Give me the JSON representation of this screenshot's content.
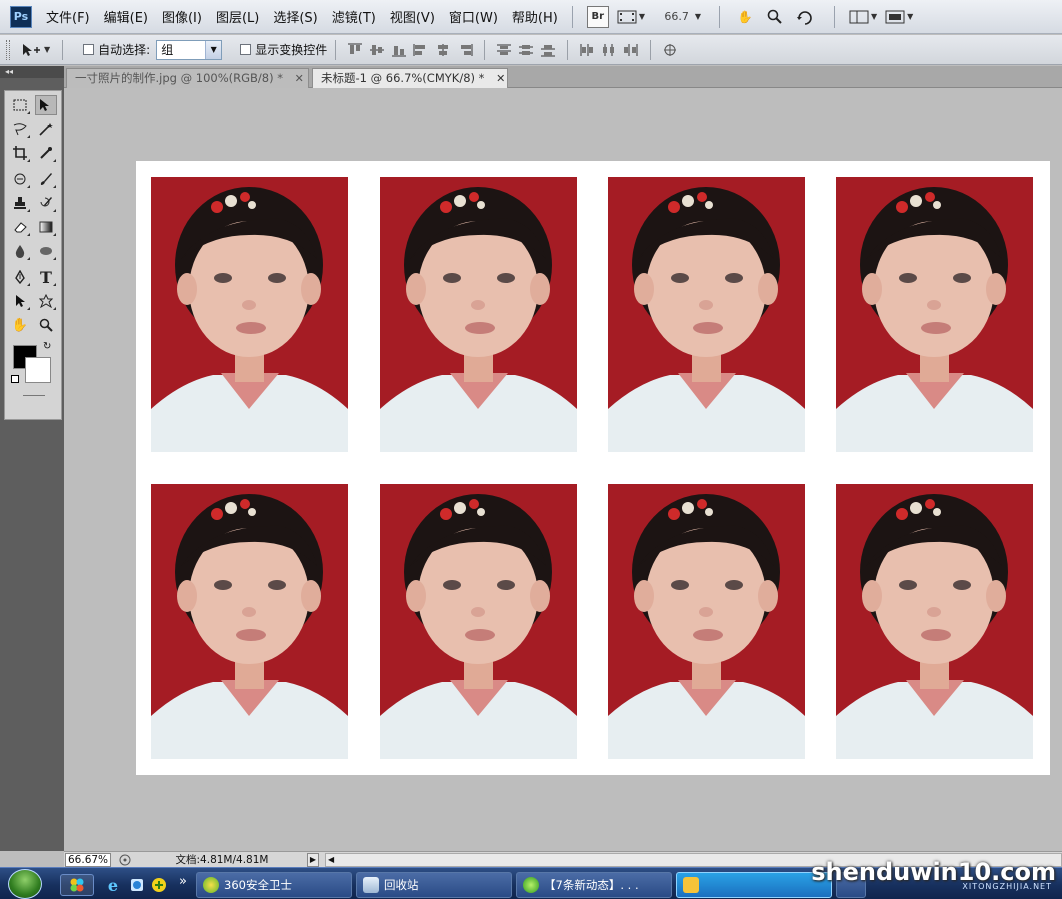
{
  "app": {
    "logo_text": "Ps"
  },
  "menu": {
    "items": [
      "文件(F)",
      "编辑(E)",
      "图像(I)",
      "图层(L)",
      "选择(S)",
      "滤镜(T)",
      "视图(V)",
      "窗口(W)",
      "帮助(H)"
    ],
    "bridge_label": "Br",
    "zoom_value": "66.7"
  },
  "options": {
    "auto_select_label": "自动选择:",
    "auto_select_value": "组",
    "show_transform_label": "显示变换控件"
  },
  "tabs": [
    {
      "label": "一寸照片的制作.jpg @ 100%(RGB/8) *",
      "active": false
    },
    {
      "label": "未标题-1 @ 66.7%(CMYK/8) *",
      "active": true
    }
  ],
  "canvas": {
    "photo_count": 8,
    "background_color": "#a51c24"
  },
  "status": {
    "zoom": "66.67%",
    "doc_info": "文档:4.81M/4.81M"
  },
  "taskbar": {
    "buttons": [
      {
        "label": "360安全卫士"
      },
      {
        "label": "回收站"
      },
      {
        "label": "【7条新动态】. . ."
      },
      {
        "label": ""
      }
    ],
    "overflow": "»"
  },
  "watermark": {
    "text": "shenduwin10.com",
    "sub": "XITONGZHIJIA.NET"
  },
  "colors": {
    "foreground": "#000000",
    "background": "#ffffff",
    "accent": "#2aa2e6"
  }
}
